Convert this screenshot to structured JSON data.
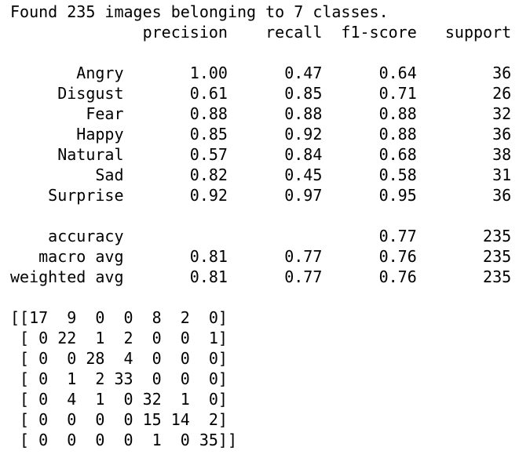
{
  "output": {
    "found_line": "Found 235 images belonging to 7 classes.",
    "report_header": "              precision    recall  f1-score   support",
    "report_rows": [
      "       Angry       1.00      0.47      0.64        36",
      "     Disgust       0.61      0.85      0.71        26",
      "        Fear       0.88      0.88      0.88        32",
      "       Happy       0.85      0.92      0.88        36",
      "     Natural       0.57      0.84      0.68        38",
      "         Sad       0.82      0.45      0.58        31",
      "    Surprise       0.92      0.97      0.95        36"
    ],
    "summary_rows": [
      "    accuracy                           0.77       235",
      "   macro avg       0.81      0.77      0.76       235",
      "weighted avg       0.81      0.77      0.76       235"
    ],
    "matrix_rows": [
      "[[17  9  0  0  8  2  0]",
      " [ 0 22  1  2  0  0  1]",
      " [ 0  0 28  4  0  0  0]",
      " [ 0  1  2 33  0  0  0]",
      " [ 0  4  1  0 32  1  0]",
      " [ 0  0  0  0 15 14  2]",
      " [ 0  0  0  0  1  0 35]]"
    ]
  }
}
